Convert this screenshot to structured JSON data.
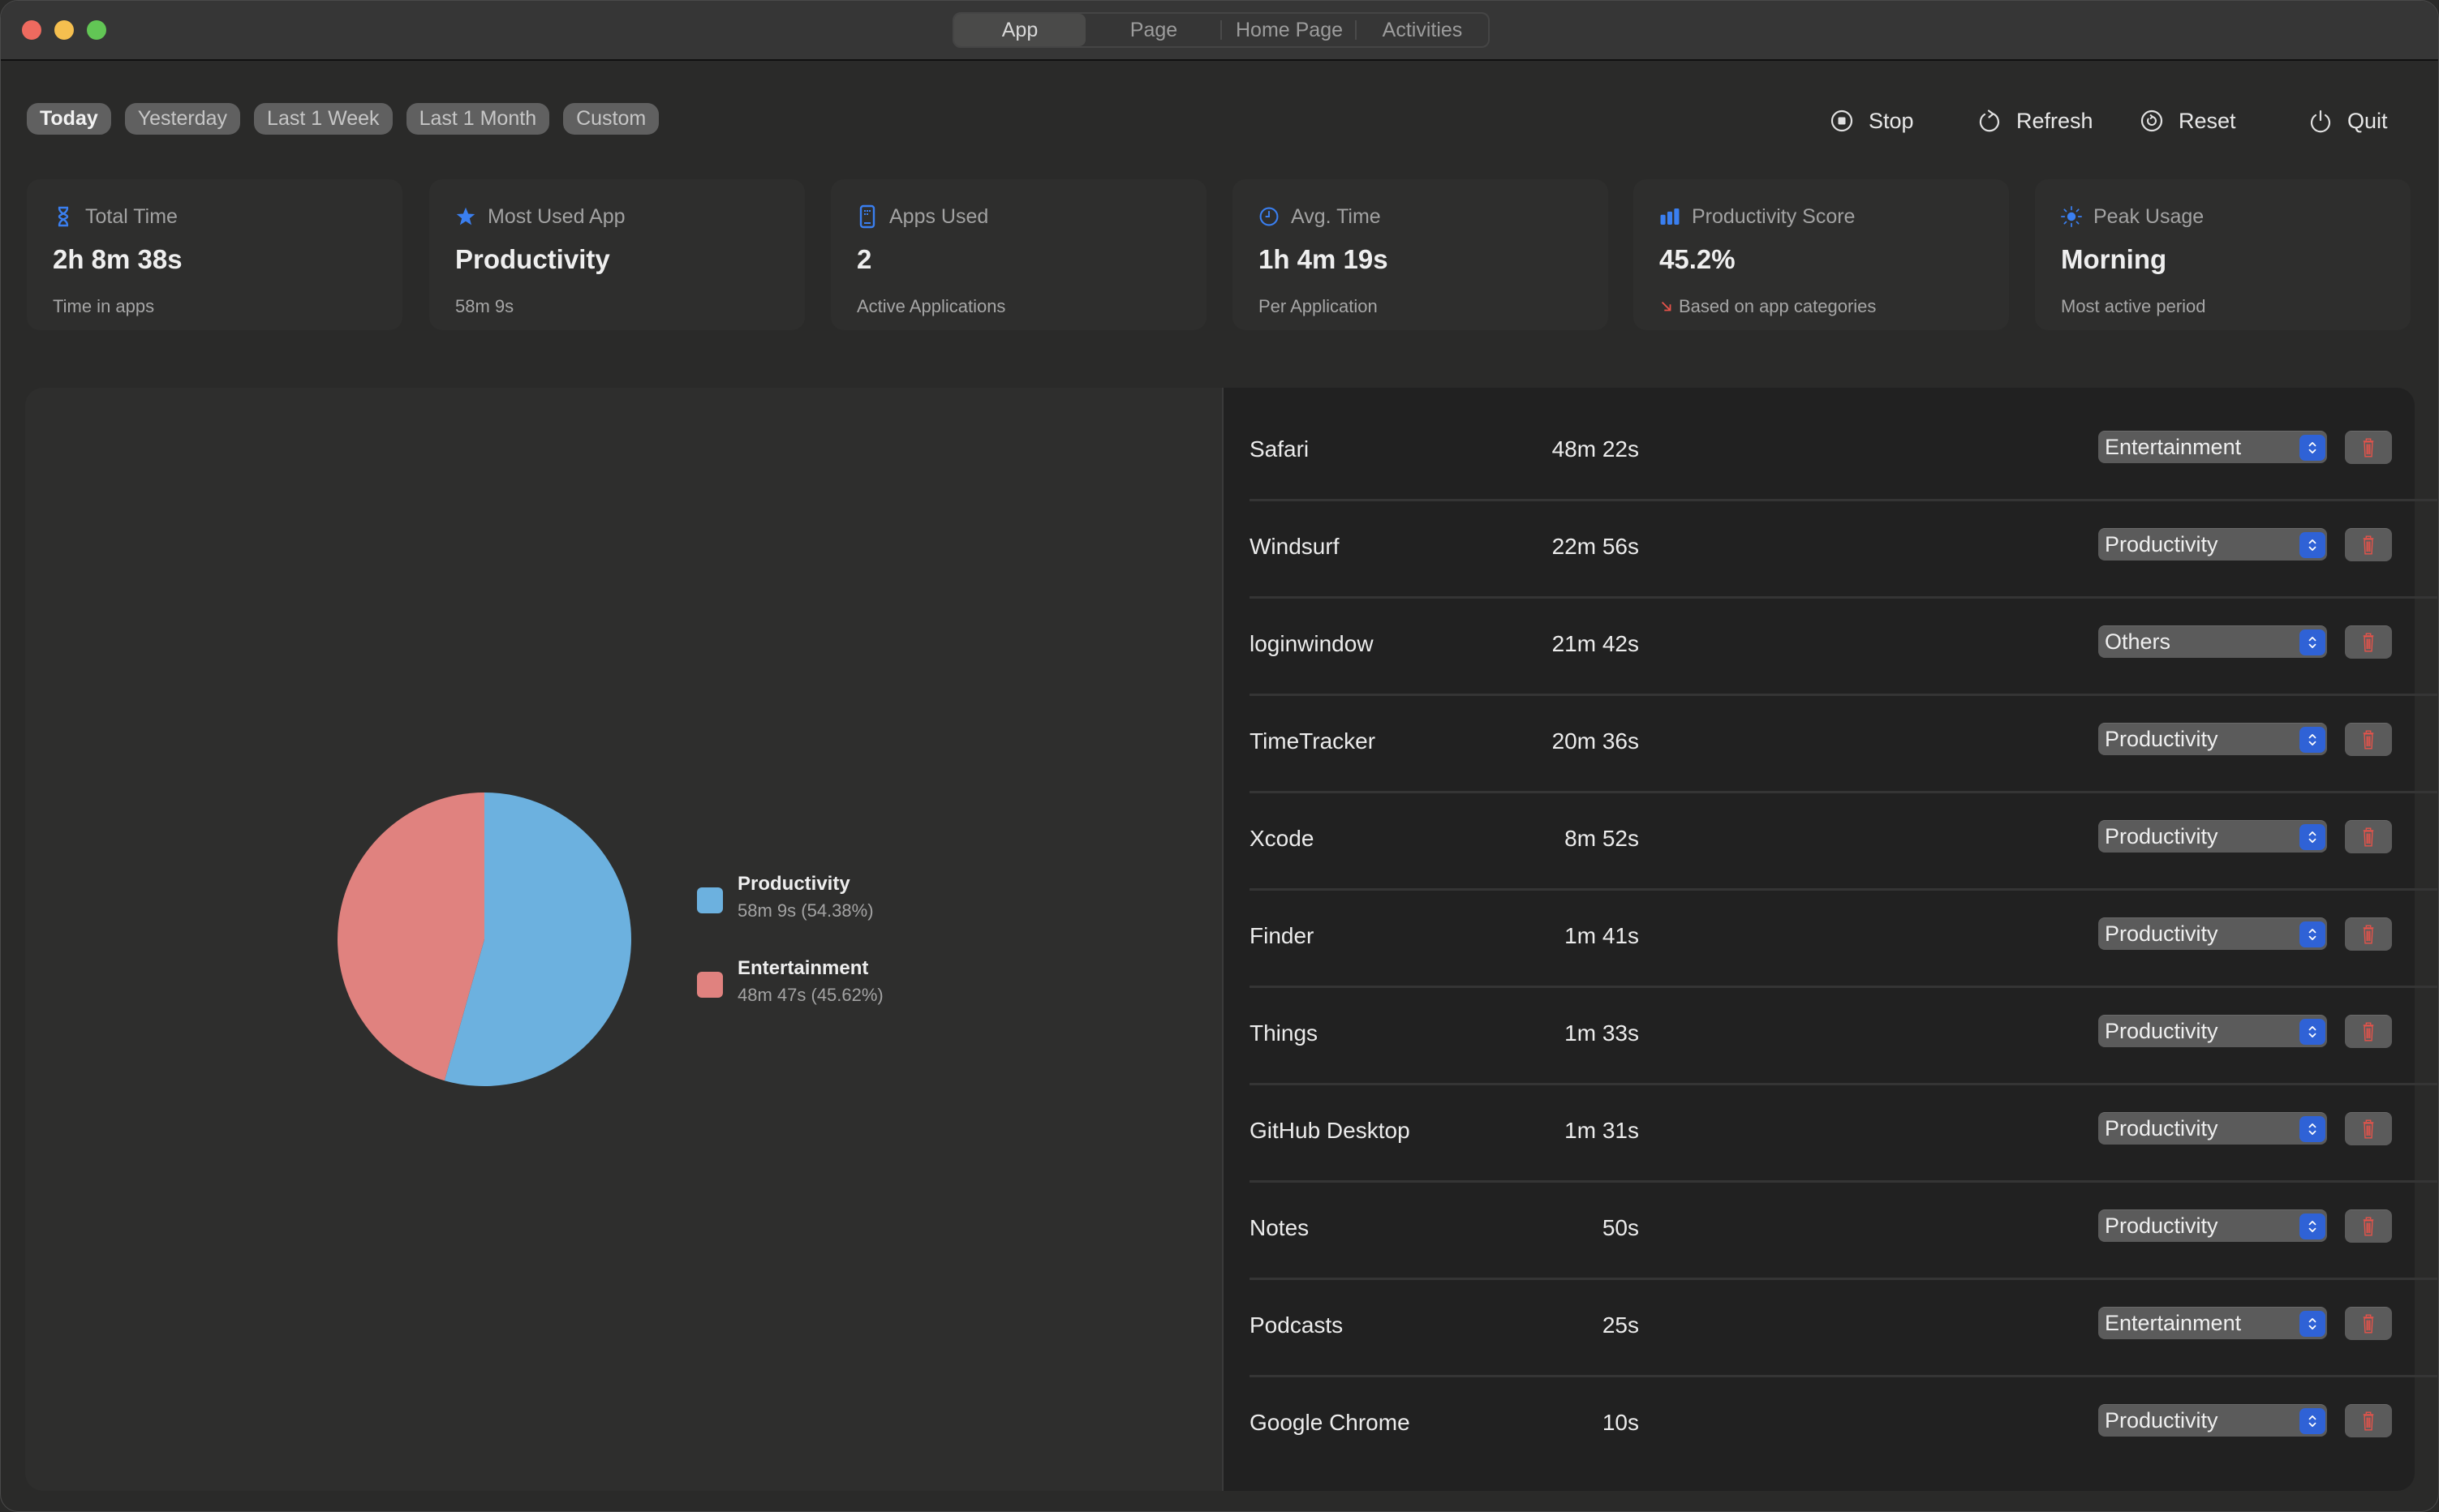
{
  "window": {
    "tabs": [
      {
        "label": "App",
        "active": true
      },
      {
        "label": "Page",
        "active": false
      },
      {
        "label": "Home Page",
        "active": false
      },
      {
        "label": "Activities",
        "active": false
      }
    ]
  },
  "filters": [
    {
      "label": "Today",
      "active": true
    },
    {
      "label": "Yesterday",
      "active": false
    },
    {
      "label": "Last 1 Week",
      "active": false
    },
    {
      "label": "Last 1 Month",
      "active": false
    },
    {
      "label": "Custom",
      "active": false
    }
  ],
  "actions": {
    "stop": {
      "label": "Stop",
      "icon": "stop-circle-icon"
    },
    "refresh": {
      "label": "Refresh",
      "icon": "refresh-icon"
    },
    "reset": {
      "label": "Reset",
      "icon": "reset-icon"
    },
    "quit": {
      "label": "Quit",
      "icon": "power-icon"
    }
  },
  "cards": [
    {
      "title": "Total Time",
      "value": "2h 8m 38s",
      "subtitle": "Time in apps",
      "icon": "hourglass-icon"
    },
    {
      "title": "Most Used App",
      "value": "Productivity",
      "subtitle": "58m 9s",
      "icon": "star-icon"
    },
    {
      "title": "Apps Used",
      "value": "2",
      "subtitle": "Active Applications",
      "icon": "app-grid-icon"
    },
    {
      "title": "Avg. Time",
      "value": "1h 4m 19s",
      "subtitle": "Per Application",
      "icon": "clock-icon"
    },
    {
      "title": "Productivity Score",
      "value": "45.2%",
      "subtitle": "Based on app categories",
      "icon": "bar-chart-icon",
      "trend": "down"
    },
    {
      "title": "Peak Usage",
      "value": "Morning",
      "subtitle": "Most active period",
      "icon": "sun-icon"
    }
  ],
  "colors": {
    "accent": "#3a7ff0",
    "productivity": "#6cb1df",
    "entertainment": "#e0827f",
    "delete": "#e8534a",
    "trend_down": "#e8534a"
  },
  "chart_data": {
    "type": "pie",
    "title": "",
    "legend_position": "right",
    "slices": [
      {
        "label": "Productivity",
        "duration": "58m 9s",
        "percent": 54.38,
        "detail": "58m 9s  (54.38%)",
        "color": "#6cb1df"
      },
      {
        "label": "Entertainment",
        "duration": "48m 47s",
        "percent": 45.62,
        "detail": "48m 47s  (45.62%)",
        "color": "#e0827f"
      }
    ]
  },
  "apps": [
    {
      "name": "Safari",
      "time": "48m 22s",
      "category": "Entertainment"
    },
    {
      "name": "Windsurf",
      "time": "22m 56s",
      "category": "Productivity"
    },
    {
      "name": "loginwindow",
      "time": "21m 42s",
      "category": "Others"
    },
    {
      "name": "TimeTracker",
      "time": "20m 36s",
      "category": "Productivity"
    },
    {
      "name": "Xcode",
      "time": "8m 52s",
      "category": "Productivity"
    },
    {
      "name": "Finder",
      "time": "1m 41s",
      "category": "Productivity"
    },
    {
      "name": "Things",
      "time": "1m 33s",
      "category": "Productivity"
    },
    {
      "name": "GitHub Desktop",
      "time": "1m 31s",
      "category": "Productivity"
    },
    {
      "name": "Notes",
      "time": "50s",
      "category": "Productivity"
    },
    {
      "name": "Podcasts",
      "time": "25s",
      "category": "Entertainment"
    },
    {
      "name": "Google Chrome",
      "time": "10s",
      "category": "Productivity"
    }
  ]
}
